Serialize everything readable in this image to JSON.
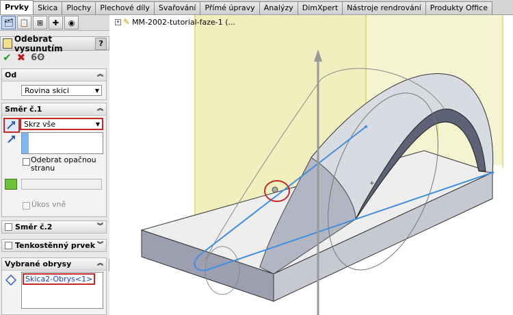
{
  "tabs": [
    "Prvky",
    "Skica",
    "Plochy",
    "Plechové díly",
    "Svařování",
    "Přímé úpravy",
    "Analýzy",
    "DimXpert",
    "Nástroje rendrování",
    "Produkty Office"
  ],
  "feature": {
    "title": "Odebrat vysunutím",
    "help": "?"
  },
  "actions": {
    "ok": "✔",
    "cancel": "✖",
    "detail": "6ʘ"
  },
  "from": {
    "header": "Od",
    "value": "Rovina skici"
  },
  "direction1": {
    "header": "Směr č.1",
    "end_condition": "Skrz vše",
    "flip_label": "Odebrat opačnou stranu",
    "draft_label": "Úkos vně"
  },
  "direction2": {
    "header": "Směr č.2"
  },
  "thin": {
    "header": "Tenkostěnný prvek"
  },
  "contours": {
    "header": "Vybrané obrysy",
    "item": "Skica2-Obrys<1>"
  },
  "tree": {
    "part_name": "MM-2002-tutorial-faze-1  (..."
  }
}
